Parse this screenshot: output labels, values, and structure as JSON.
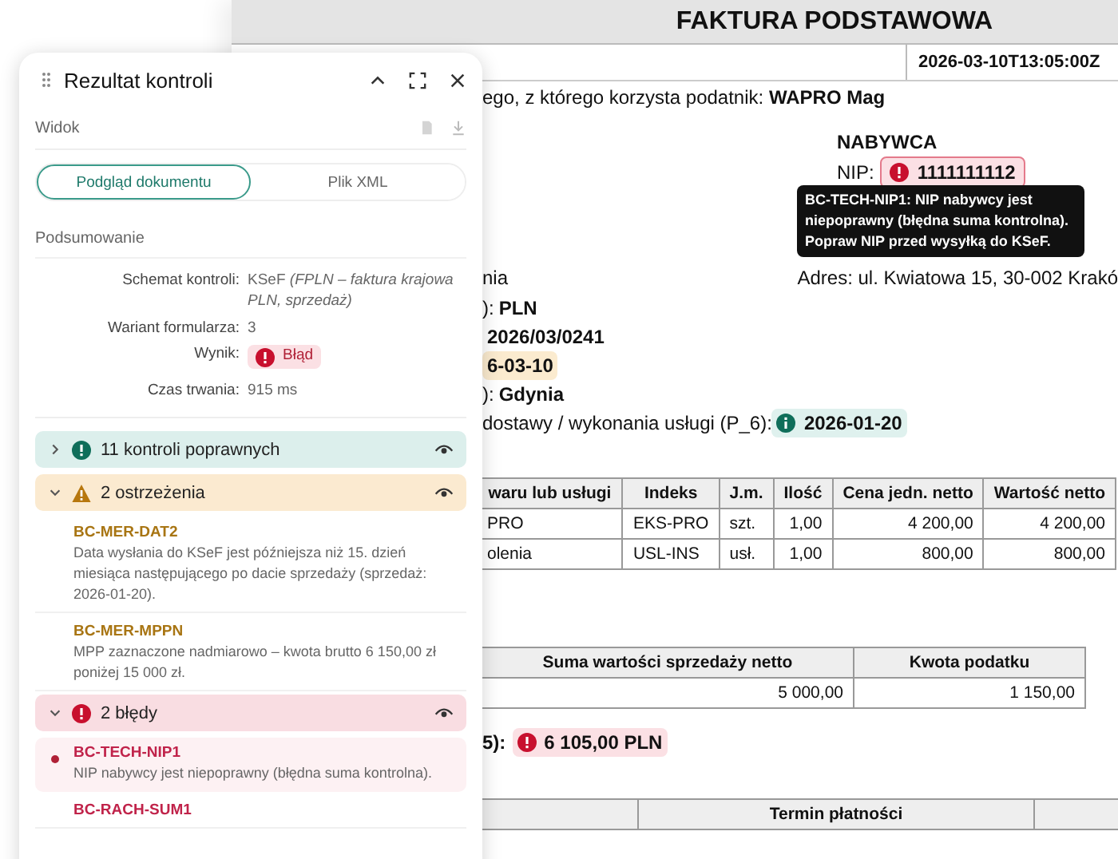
{
  "document": {
    "title": "FAKTURA PODSTAWOWA",
    "timestamp": "2026-03-10T13:05:00Z",
    "software_line": {
      "text": "ego, z którego korzysta podatnik: ",
      "value": "WAPRO Mag"
    },
    "buyer": {
      "heading": "NABYWCA",
      "nip": {
        "label": "NIP:",
        "value": "1111111112",
        "kind": "error"
      },
      "address": "Adres: ul. Kwiatowa 15, 30-002 Krakó"
    },
    "left_fragment": "nia",
    "fields": [
      {
        "label": "): ",
        "value": "PLN",
        "kind": "plain"
      },
      {
        "value": "2026/03/0241",
        "kind": "plain"
      },
      {
        "value": "6-03-10",
        "kind": "warning"
      },
      {
        "label": "): ",
        "value": "Gdynia",
        "kind": "plain"
      },
      {
        "label": "dostawy / wykonania usługi (P_6): ",
        "value": "2026-01-20",
        "kind": "ok"
      }
    ],
    "items_table": {
      "columns": [
        "waru lub usługi",
        "Indeks",
        "J.m.",
        "Ilość",
        "Cena jedn. netto",
        "Wartość netto"
      ],
      "rows": [
        [
          "PRO",
          "EKS-PRO",
          "szt.",
          "1,00",
          "4 200,00",
          "4 200,00"
        ],
        [
          "olenia",
          "USL-INS",
          "usł.",
          "1,00",
          "800,00",
          "800,00"
        ]
      ]
    },
    "totals_table": {
      "columns": [
        "Suma wartości sprzedaży netto",
        "Kwota podatku"
      ],
      "rows": [
        [
          "5 000,00",
          "1 150,00"
        ]
      ]
    },
    "gross": {
      "label": "5):",
      "value": "6 105,00 PLN",
      "kind": "error"
    },
    "payment_table": {
      "columns": [
        "",
        "Termin płatności",
        ""
      ]
    },
    "tooltip": "BC-TECH-NIP1: NIP nabywcy jest niepoprawny (błędna suma kontrolna). Popraw NIP przed wysyłką do KSeF."
  },
  "panel": {
    "title": "Rezultat kontroli",
    "view_label": "Widok",
    "tabs": [
      {
        "label": "Podgląd dokumentu",
        "selected": true
      },
      {
        "label": "Plik XML",
        "selected": false
      }
    ],
    "summary_heading": "Podsumowanie",
    "summary": [
      {
        "label": "Schemat kontroli:",
        "value": "KSeF",
        "note": "(FPLN – faktura krajowa PLN, sprzedaż)",
        "kind": "text"
      },
      {
        "label": "Wariant formularza:",
        "value": "3",
        "kind": "text"
      },
      {
        "label": "Wynik:",
        "value": "Błąd",
        "kind": "status"
      },
      {
        "label": "Czas trwania:",
        "value": "915 ms",
        "kind": "text"
      }
    ],
    "groups": [
      {
        "kind": "ok",
        "label": "11 kontroli poprawnych",
        "expanded": false
      },
      {
        "kind": "warning",
        "label": "2 ostrzeżenia",
        "expanded": true,
        "items": [
          {
            "code": "BC-MER-DAT2",
            "message": "Data wysłania do KSeF jest późniejsza niż 15. dzień miesiąca następującego po dacie sprzedaży (sprzedaż: 2026-01-20).",
            "selected": false
          },
          {
            "code": "BC-MER-MPPN",
            "message": "MPP zaznaczone nadmiarowo – kwota brutto 6 150,00 zł poniżej 15 000 zł.",
            "selected": false
          }
        ]
      },
      {
        "kind": "error",
        "label": "2 błędy",
        "expanded": true,
        "items": [
          {
            "code": "BC-TECH-NIP1",
            "message": "NIP nabywcy jest niepoprawny (błędna suma kontrolna).",
            "selected": true
          },
          {
            "code": "BC-RACH-SUM1",
            "selected": false
          }
        ]
      }
    ]
  }
}
